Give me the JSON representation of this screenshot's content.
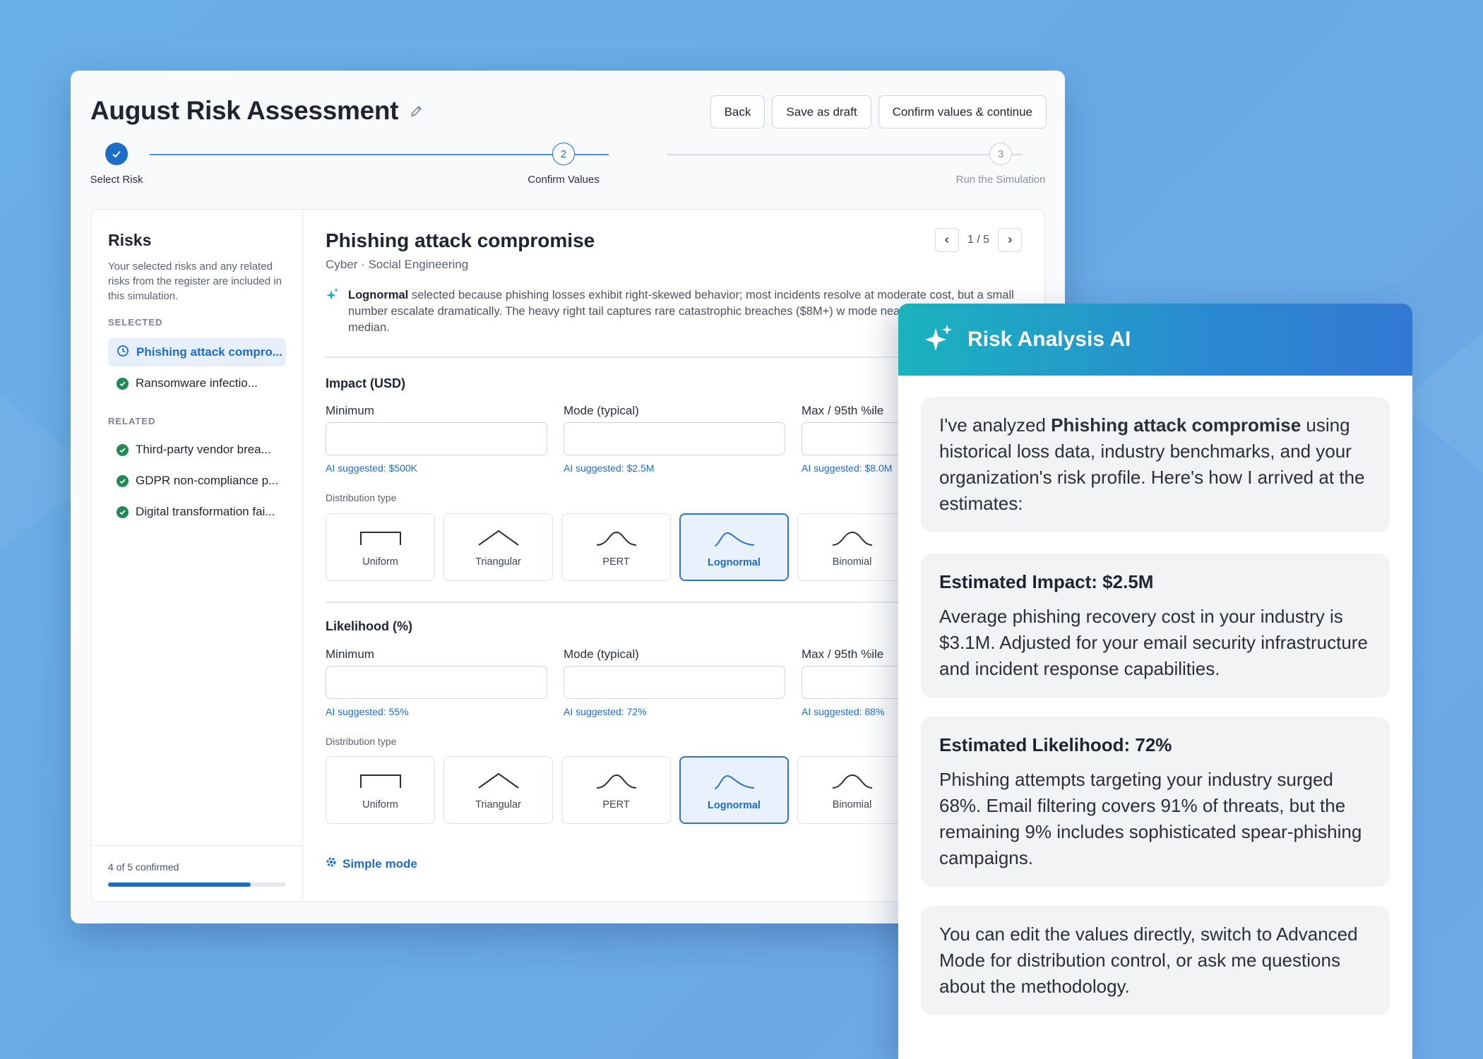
{
  "header": {
    "title": "August Risk Assessment",
    "back_label": "Back",
    "save_draft_label": "Save as draft",
    "confirm_label": "Confirm values & continue"
  },
  "stepper": {
    "steps": [
      {
        "number": "1",
        "label": "Select Risk",
        "state": "complete"
      },
      {
        "number": "2",
        "label": "Confirm Values",
        "state": "current"
      },
      {
        "number": "3",
        "label": "Run the Simulation",
        "state": "upcoming"
      }
    ]
  },
  "sidebar": {
    "title": "Risks",
    "description": "Your selected risks and any related risks from the register are included in this simulation.",
    "selected_heading": "SELECTED",
    "selected": [
      {
        "label": "Phishing attack compro...",
        "state": "active"
      },
      {
        "label": "Ransomware infectio...",
        "state": "confirmed"
      }
    ],
    "related_heading": "RELATED",
    "related": [
      {
        "label": "Third-party vendor brea..."
      },
      {
        "label": "GDPR non-compliance p..."
      },
      {
        "label": "Digital transformation fai..."
      }
    ],
    "progress_label": "4 of 5 confirmed",
    "progress_fraction": 0.8
  },
  "risk": {
    "title": "Phishing attack compromise",
    "subtitle": "Cyber · Social Engineering",
    "pager_text": "1 / 5",
    "ai_note_bold": "Lognormal",
    "ai_note_text": " selected because phishing losses exhibit right-skewed behavior; most incidents resolve at moderate cost, but a small number escalate dramatically. The heavy right tail captures rare catastrophic breaches ($8M+) w mode near the $2.5M industry median."
  },
  "impact": {
    "title": "Impact (USD)",
    "min_label": "Minimum",
    "mode_label": "Mode (typical)",
    "max_label": "Max / 95th %ile",
    "min_sugg": "AI suggested: $500K",
    "mode_sugg": "AI suggested: $2.5M",
    "max_sugg": "AI suggested: $8.0M",
    "dist_label": "Distribution type"
  },
  "likelihood": {
    "title": "Likelihood (%)",
    "min_label": "Minimum",
    "mode_label": "Mode (typical)",
    "max_label": "Max / 95th %ile",
    "min_sugg": "AI suggested: 55%",
    "mode_sugg": "AI suggested: 72%",
    "max_sugg": "AI suggested: 88%",
    "dist_label": "Distribution type"
  },
  "distributions": [
    "Uniform",
    "Triangular",
    "PERT",
    "Lognormal",
    "Binomial"
  ],
  "selected_distribution": "Lognormal",
  "simple_mode_label": "Simple mode",
  "ai_panel": {
    "title": "Risk Analysis AI",
    "intro_pre": "I've analyzed ",
    "intro_bold": "Phishing attack compromise",
    "intro_post": " using historical loss data, industry benchmarks, and your organization's risk profile. Here's how I arrived at the estimates:",
    "impact_title": "Estimated Impact: $2.5M",
    "impact_text": "Average phishing recovery cost in your industry is $3.1M. Adjusted for your email security infrastructure and incident response capabilities.",
    "likelihood_title": "Estimated Likelihood: 72%",
    "likelihood_text": "Phishing attempts targeting your industry surged 68%. Email filtering covers 91% of threats, but the remaining 9% includes sophisticated spear-phishing campaigns.",
    "outro": "You can edit the values directly, switch to Advanced Mode for distribution control, or ask me questions about the methodology."
  },
  "colors": {
    "accent": "#1d6cc8",
    "success": "#1e8a55",
    "ai_gradient_start": "#1ab3be",
    "ai_gradient_end": "#3378d4"
  }
}
